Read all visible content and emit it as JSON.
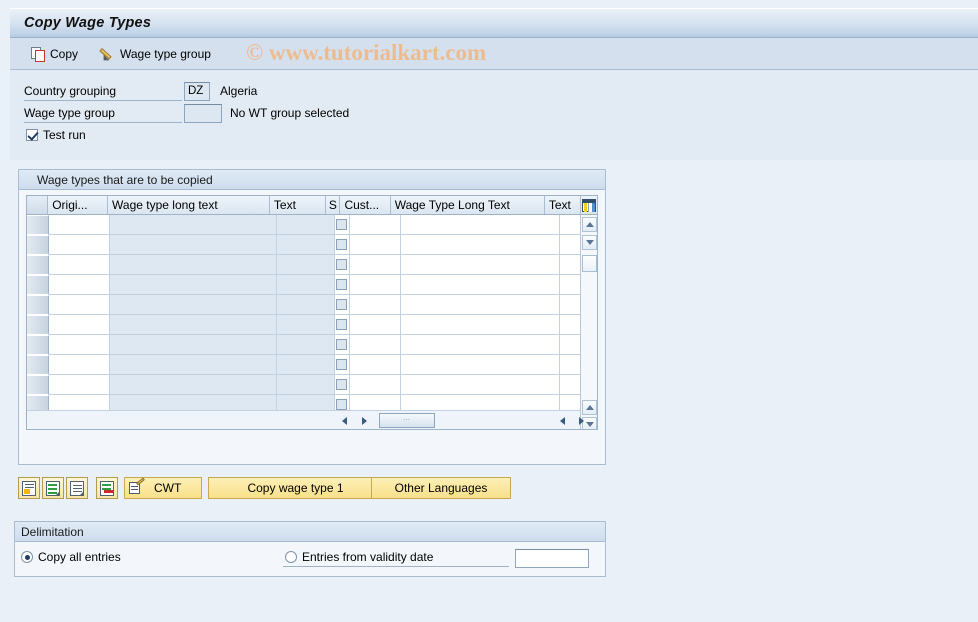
{
  "window": {
    "title": "Copy Wage Types"
  },
  "watermark": "© www.tutorialkart.com",
  "toolbar": {
    "copy_label": "Copy",
    "wage_type_group_label": "Wage type group"
  },
  "form": {
    "country_grouping": {
      "label": "Country grouping",
      "value": "DZ",
      "description": "Algeria"
    },
    "wage_type_group": {
      "label": "Wage type group",
      "value": "",
      "description": "No WT group selected"
    },
    "test_run": {
      "label": "Test run",
      "checked": true
    }
  },
  "table_group": {
    "title": "Wage types that are to be copied",
    "columns": [
      {
        "key": "selector",
        "label": ""
      },
      {
        "key": "orig",
        "label": "Origi..."
      },
      {
        "key": "wage_type_long_text",
        "label": "Wage type long text"
      },
      {
        "key": "text1",
        "label": "Text"
      },
      {
        "key": "s",
        "label": "S"
      },
      {
        "key": "cust",
        "label": "Cust..."
      },
      {
        "key": "wage_type_long_text_2",
        "label": "Wage Type Long Text"
      },
      {
        "key": "text2",
        "label": "Text"
      },
      {
        "key": "settings",
        "label": ""
      }
    ],
    "rows": [
      {
        "orig": "",
        "wage_type_long_text": "",
        "text1": "",
        "s": false,
        "cust": "",
        "wage_type_long_text_2": "",
        "text2": ""
      },
      {
        "orig": "",
        "wage_type_long_text": "",
        "text1": "",
        "s": false,
        "cust": "",
        "wage_type_long_text_2": "",
        "text2": ""
      },
      {
        "orig": "",
        "wage_type_long_text": "",
        "text1": "",
        "s": false,
        "cust": "",
        "wage_type_long_text_2": "",
        "text2": ""
      },
      {
        "orig": "",
        "wage_type_long_text": "",
        "text1": "",
        "s": false,
        "cust": "",
        "wage_type_long_text_2": "",
        "text2": ""
      },
      {
        "orig": "",
        "wage_type_long_text": "",
        "text1": "",
        "s": false,
        "cust": "",
        "wage_type_long_text_2": "",
        "text2": ""
      },
      {
        "orig": "",
        "wage_type_long_text": "",
        "text1": "",
        "s": false,
        "cust": "",
        "wage_type_long_text_2": "",
        "text2": ""
      },
      {
        "orig": "",
        "wage_type_long_text": "",
        "text1": "",
        "s": false,
        "cust": "",
        "wage_type_long_text_2": "",
        "text2": ""
      },
      {
        "orig": "",
        "wage_type_long_text": "",
        "text1": "",
        "s": false,
        "cust": "",
        "wage_type_long_text_2": "",
        "text2": ""
      },
      {
        "orig": "",
        "wage_type_long_text": "",
        "text1": "",
        "s": false,
        "cust": "",
        "wage_type_long_text_2": "",
        "text2": ""
      },
      {
        "orig": "",
        "wage_type_long_text": "",
        "text1": "",
        "s": false,
        "cust": "",
        "wage_type_long_text_2": "",
        "text2": ""
      },
      {
        "orig": "",
        "wage_type_long_text": "",
        "text1": "",
        "s": false,
        "cust": "",
        "wage_type_long_text_2": "",
        "text2": ""
      }
    ],
    "settings_icon": "table-settings-icon"
  },
  "actions": {
    "icon_buttons": [
      {
        "name": "insert-row-icon"
      },
      {
        "name": "copy-rows-icon"
      },
      {
        "name": "paste-rows-icon"
      },
      {
        "name": "delete-row-icon"
      }
    ],
    "cwt_label": "CWT",
    "copy_wage_type_label": "Copy wage type 1",
    "other_languages_label": "Other Languages"
  },
  "delimitation": {
    "title": "Delimitation",
    "copy_all_entries": {
      "label": "Copy all entries",
      "selected": true
    },
    "entries_from_validity_date": {
      "label": "Entries from validity date",
      "selected": false
    },
    "validity_date_value": ""
  },
  "colors": {
    "page_background": "#eaf0f7",
    "title_bar": "#c0d3e8",
    "toolbar": "#d4e0ee",
    "button_yellow": "#f8e08a",
    "accent_border": "#a9bdd2",
    "watermark": "#eebb8b"
  }
}
